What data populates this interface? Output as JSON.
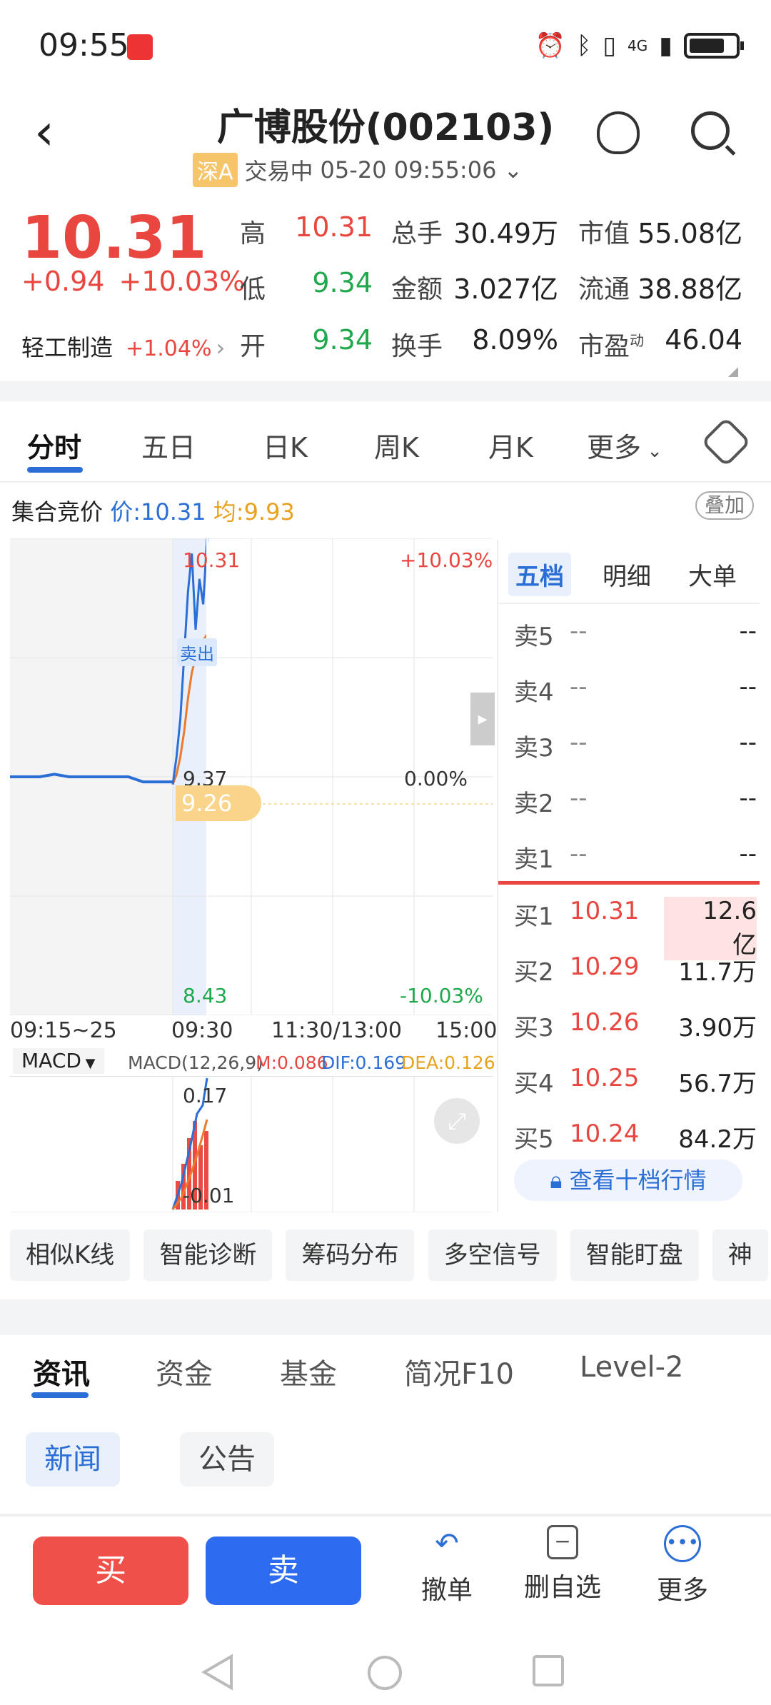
{
  "status": {
    "time": "09:55",
    "network": "4G"
  },
  "header": {
    "title": "广博股份(002103)",
    "market": "深A",
    "state": "交易中",
    "datetime": "05-20 09:55:06"
  },
  "quote": {
    "price": "10.31",
    "change": "+0.94",
    "change_pct": "+10.03%",
    "industry": "轻工制造",
    "industry_chg": "+1.04%",
    "high_label": "高",
    "high": "10.31",
    "low_label": "低",
    "low": "9.34",
    "open_label": "开",
    "open": "9.34",
    "vol_label": "总手",
    "vol": "30.49万",
    "amount_label": "金额",
    "amount": "3.027亿",
    "turnover_label": "换手",
    "turnover": "8.09%",
    "mcap_label": "市值",
    "mcap": "55.08亿",
    "float_label": "流通",
    "float": "38.88亿",
    "pe_label": "市盈",
    "pe_sup": "动",
    "pe": "46.04"
  },
  "chart_tabs": [
    "分时",
    "五日",
    "日K",
    "周K",
    "月K",
    "更多"
  ],
  "auction": {
    "label": "集合竞价",
    "price_label": "价:",
    "price": "10.31",
    "avg_label": "均:",
    "avg": "9.93"
  },
  "overlay_label": "叠加",
  "chart_labels": {
    "top_price": "10.31",
    "top_pct": "+10.03%",
    "mid_price": "9.37",
    "mid_pct": "0.00%",
    "bottom_price": "8.43",
    "bottom_pct": "-10.03%",
    "cursor_price": "9.26",
    "sell_marker": "卖出"
  },
  "x_axis": [
    "09:15~25",
    "09:30",
    "11:30/13:00",
    "15:00"
  ],
  "macd": {
    "name": "MACD",
    "params": "MACD(12,26,9)",
    "m": "M:0.086",
    "dif": "DIF:0.169",
    "dea": "DEA:0.126",
    "top": "0.17",
    "bottom": "-0.01"
  },
  "chart_data": {
    "type": "line",
    "ylim": [
      8.43,
      10.31
    ],
    "baseline": 9.37,
    "series": [
      {
        "values_preopen": [
          9.37,
          9.37,
          9.37,
          9.38,
          9.37,
          9.37,
          9.37,
          9.37,
          9.37,
          9.35,
          9.35,
          9.35
        ]
      },
      {
        "values_intraday": [
          9.34,
          9.45,
          9.6,
          9.85,
          10.1,
          10.25,
          9.95,
          10.15,
          10.05,
          10.31
        ]
      },
      {
        "values_avg": [
          9.34,
          9.38,
          9.45,
          9.55,
          9.68,
          9.78,
          9.84,
          9.88,
          9.91,
          9.93
        ]
      }
    ]
  },
  "book_tabs": [
    "五档",
    "明细",
    "大单"
  ],
  "asks": [
    {
      "label": "卖5",
      "price": "--",
      "vol": "--"
    },
    {
      "label": "卖4",
      "price": "--",
      "vol": "--"
    },
    {
      "label": "卖3",
      "price": "--",
      "vol": "--"
    },
    {
      "label": "卖2",
      "price": "--",
      "vol": "--"
    },
    {
      "label": "卖1",
      "price": "--",
      "vol": "--"
    }
  ],
  "bids": [
    {
      "label": "买1",
      "price": "10.31",
      "vol": "12.6亿"
    },
    {
      "label": "买2",
      "price": "10.29",
      "vol": "11.7万"
    },
    {
      "label": "买3",
      "price": "10.26",
      "vol": "3.90万"
    },
    {
      "label": "买4",
      "price": "10.25",
      "vol": "56.7万"
    },
    {
      "label": "买5",
      "price": "10.24",
      "vol": "84.2万"
    }
  ],
  "ten_level": "查看十档行情",
  "tools": [
    "相似K线",
    "智能诊断",
    "筹码分布",
    "多空信号",
    "智能盯盘",
    "神"
  ],
  "news_tabs": [
    "资讯",
    "资金",
    "基金",
    "简况F10",
    "Level-2"
  ],
  "news_subtabs": [
    "新闻",
    "公告"
  ],
  "bottom": {
    "buy": "买",
    "sell": "卖",
    "cancel": "撤单",
    "del_fav": "删自选",
    "more": "更多"
  }
}
